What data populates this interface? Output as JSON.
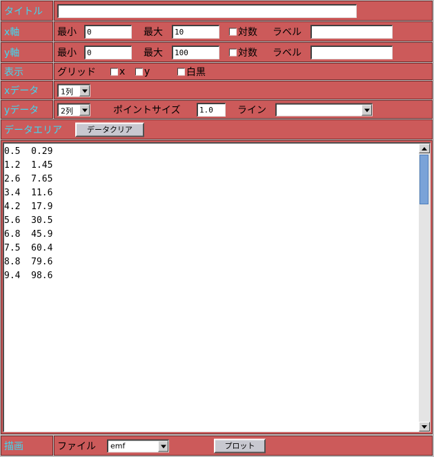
{
  "title_row": {
    "label": "タイトル",
    "value": ""
  },
  "x_axis": {
    "label": "x軸",
    "min_label": "最小",
    "min_value": "0",
    "max_label": "最大",
    "max_value": "10",
    "log_label": "対数",
    "label_label": "ラベル",
    "label_value": ""
  },
  "y_axis": {
    "label": "y軸",
    "min_label": "最小",
    "min_value": "0",
    "max_label": "最大",
    "max_value": "100",
    "log_label": "対数",
    "label_label": "ラベル",
    "label_value": ""
  },
  "display": {
    "label": "表示",
    "grid_label": "グリッド",
    "grid_x_label": "x",
    "grid_y_label": "y",
    "bw_label": "白黒"
  },
  "x_data": {
    "label": "xデータ",
    "column": "1列"
  },
  "y_data": {
    "label": "yデータ",
    "column": "2列",
    "point_size_label": "ポイントサイズ",
    "point_size_value": "1.0",
    "line_label": "ライン",
    "line_value": ""
  },
  "data_area": {
    "label": "データエリア",
    "clear_button": "データクリア",
    "lines": [
      "0.5  0.29",
      "1.2  1.45",
      "2.6  7.65",
      "3.4  11.6",
      "4.2  17.9",
      "5.6  30.5",
      "6.8  45.9",
      "7.5  60.4",
      "8.8  79.6",
      "9.4  98.6"
    ]
  },
  "draw": {
    "label": "描画",
    "file_label": "ファイル",
    "file_format": "emf",
    "plot_button": "プロット"
  }
}
